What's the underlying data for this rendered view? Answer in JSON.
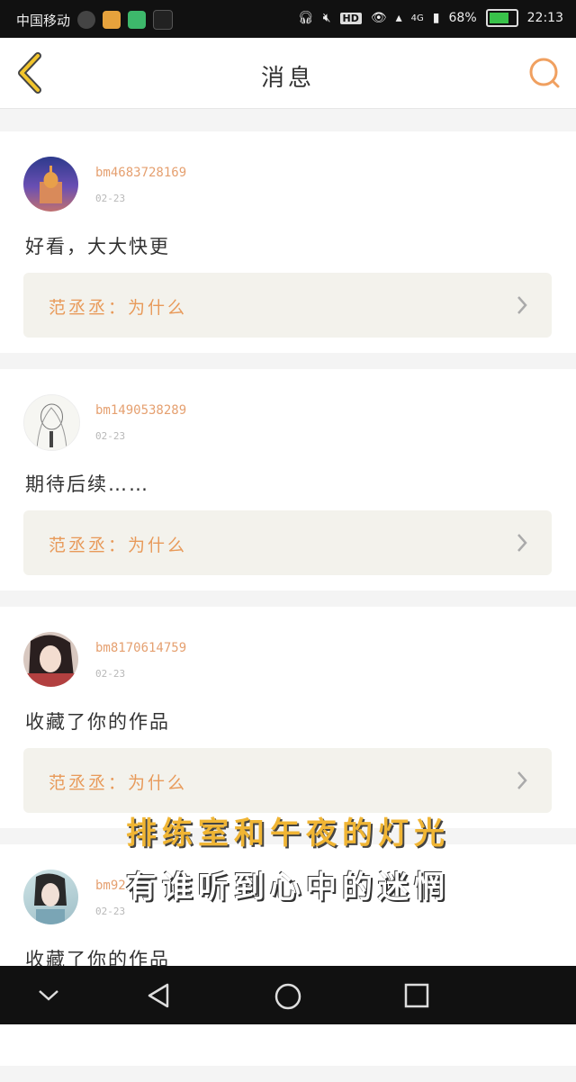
{
  "status_bar": {
    "carrier": "中国移动",
    "network": "4G",
    "battery": "68%",
    "time": "22:13",
    "hd_badge": "HD",
    "icons": [
      "headphones-icon",
      "mute-icon",
      "eye-icon",
      "wifi-icon",
      "signal-icon"
    ]
  },
  "header": {
    "title": "消息",
    "back_icon": "chevron-left-icon",
    "search_icon": "search-icon"
  },
  "messages": [
    {
      "username": "bm4683728169",
      "date": "02-23",
      "comment": "好看，大大快更",
      "quote": "范丞丞：为什么"
    },
    {
      "username": "bm1490538289",
      "date": "02-23",
      "comment": "期待后续……",
      "quote": "范丞丞：为什么"
    },
    {
      "username": "bm8170614759",
      "date": "02-23",
      "comment": "收藏了你的作品",
      "quote": "范丞丞：为什么"
    },
    {
      "username": "bm92",
      "date": "02-23",
      "comment": "收藏了你的作品",
      "quote": ""
    }
  ],
  "overlay_subtitles": {
    "line1": "排练室和午夜的灯光",
    "line2": "有谁听到心中的迷惘"
  },
  "colors": {
    "accent": "#f0a060",
    "username": "#e5a070",
    "quote_bg": "#f3f2ec"
  }
}
